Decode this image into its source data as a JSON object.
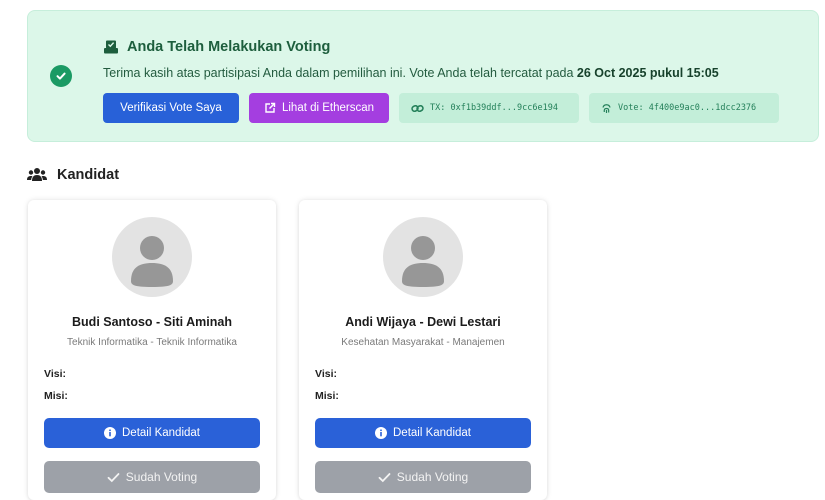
{
  "alert": {
    "title": "Anda Telah Melakukan Voting",
    "message_prefix": "Terima kasih atas partisipasi Anda dalam pemilihan ini. Vote Anda telah tercatat pada ",
    "message_date": "26 Oct 2025 pukul 15:05",
    "verify_label": "Verifikasi Vote Saya",
    "etherscan_label": "Lihat di Etherscan",
    "tx_label": "TX: 0xf1b39ddf...9cc6e194",
    "vote_label": "Vote: 4f400e9ac0...1dcc2376",
    "colors": {
      "success": "#1b9a64",
      "primary": "#2861d8",
      "etherscan": "#a43ee0"
    }
  },
  "section": {
    "title": "Kandidat",
    "icon": "users-icon"
  },
  "candidates": [
    {
      "name": "Budi Santoso - Siti Aminah",
      "major": "Teknik Informatika - Teknik Informatika",
      "visi_label": "Visi:",
      "misi_label": "Misi:",
      "detail_label": "Detail Kandidat",
      "voted_label": "Sudah Voting"
    },
    {
      "name": "Andi Wijaya - Dewi Lestari",
      "major": "Kesehatan Masyarakat - Manajemen",
      "visi_label": "Visi:",
      "misi_label": "Misi:",
      "detail_label": "Detail Kandidat",
      "voted_label": "Sudah Voting"
    }
  ]
}
